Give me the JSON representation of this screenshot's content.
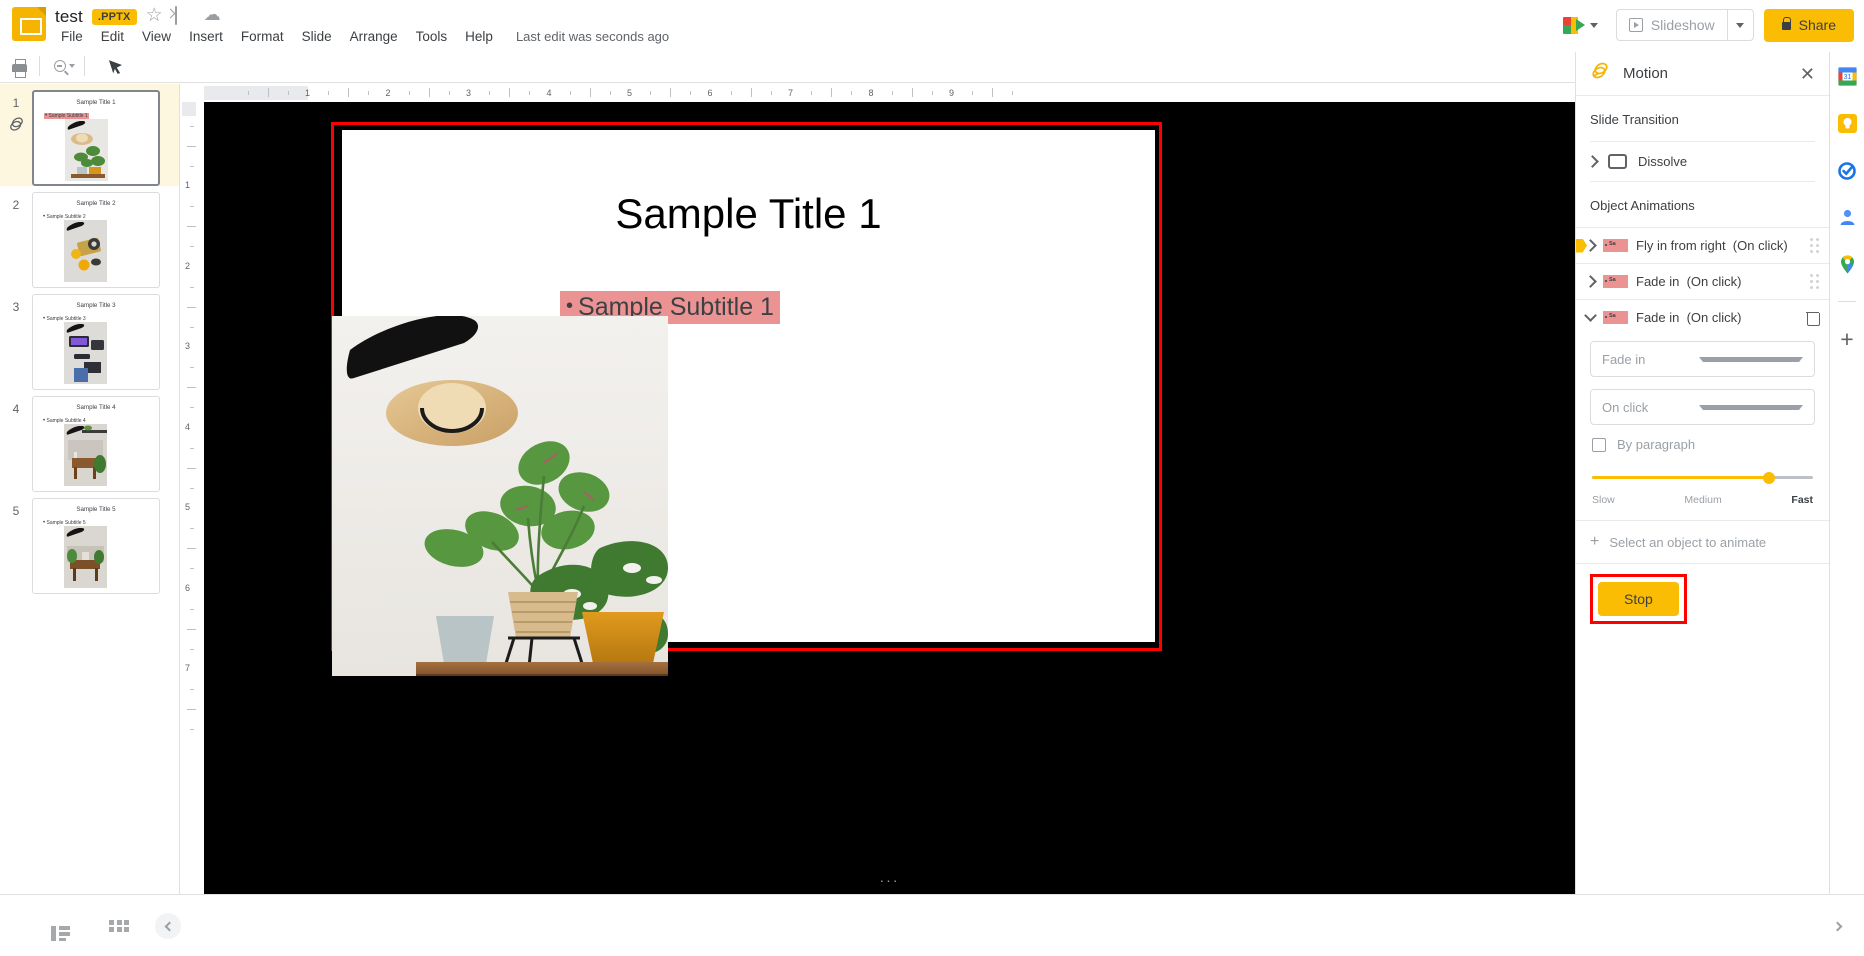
{
  "app": {
    "doc_title": "test",
    "file_badge": ".PPTX",
    "last_edit": "Last edit was seconds ago"
  },
  "menubar": {
    "items": [
      "File",
      "Edit",
      "View",
      "Insert",
      "Format",
      "Slide",
      "Arrange",
      "Tools",
      "Help"
    ]
  },
  "topright": {
    "slideshow_label": "Slideshow",
    "share_label": "Share"
  },
  "filmstrip": {
    "slides": [
      {
        "num": "1",
        "title": "Sample Title 1",
        "subtitle": "Sample Subtitle 1",
        "selected": true,
        "highlighted": true,
        "has_animation": true
      },
      {
        "num": "2",
        "title": "Sample Title 2",
        "subtitle": "Sample Subtitle 2",
        "selected": false,
        "highlighted": false,
        "has_animation": false
      },
      {
        "num": "3",
        "title": "Sample Title 3",
        "subtitle": "Sample Subtitle 3",
        "selected": false,
        "highlighted": false,
        "has_animation": false
      },
      {
        "num": "4",
        "title": "Sample Title 4",
        "subtitle": "Sample Subtitle 4",
        "selected": false,
        "highlighted": false,
        "has_animation": false
      },
      {
        "num": "5",
        "title": "Sample Title 5",
        "subtitle": "Sample Subtitle 5",
        "selected": false,
        "highlighted": false,
        "has_animation": false
      }
    ]
  },
  "slide": {
    "title": "Sample Title 1",
    "subtitle": "Sample Subtitle 1",
    "bullet": "•",
    "page_dots": "···"
  },
  "ruler": {
    "h_numbers": [
      "1",
      "2",
      "3",
      "4",
      "5",
      "6",
      "7",
      "8",
      "9"
    ],
    "v_numbers": [
      "1",
      "2",
      "3",
      "4",
      "5",
      "6",
      "7"
    ]
  },
  "motion_panel": {
    "title": "Motion",
    "close_label": "✕",
    "slide_transition_label": "Slide Transition",
    "transition_name": "Dissolve",
    "object_animations_label": "Object Animations",
    "animations": [
      {
        "name": "Fly in from right",
        "trigger": "(On click)",
        "expanded": false,
        "active": true
      },
      {
        "name": "Fade in",
        "trigger": "(On click)",
        "expanded": false,
        "active": false
      },
      {
        "name": "Fade in",
        "trigger": "(On click)",
        "expanded": true,
        "active": false
      }
    ],
    "detail": {
      "effect_value": "Fade in",
      "trigger_value": "On click",
      "by_paragraph_label": "By paragraph",
      "by_paragraph_checked": false,
      "speed_labels": {
        "slow": "Slow",
        "medium": "Medium",
        "fast": "Fast"
      },
      "speed_percent": 80
    },
    "add_object_label": "Select an object to animate",
    "add_object_plus": "+",
    "stop_label": "Stop"
  },
  "colors": {
    "accent_yellow": "#FBBC04",
    "highlight_pink": "#EB9293",
    "selection_red": "#FF0000",
    "canvas_black": "#000000"
  },
  "rail": {
    "icons": [
      "calendar-icon",
      "keep-icon",
      "tasks-icon",
      "contacts-icon",
      "maps-icon"
    ],
    "add_label": "+"
  }
}
